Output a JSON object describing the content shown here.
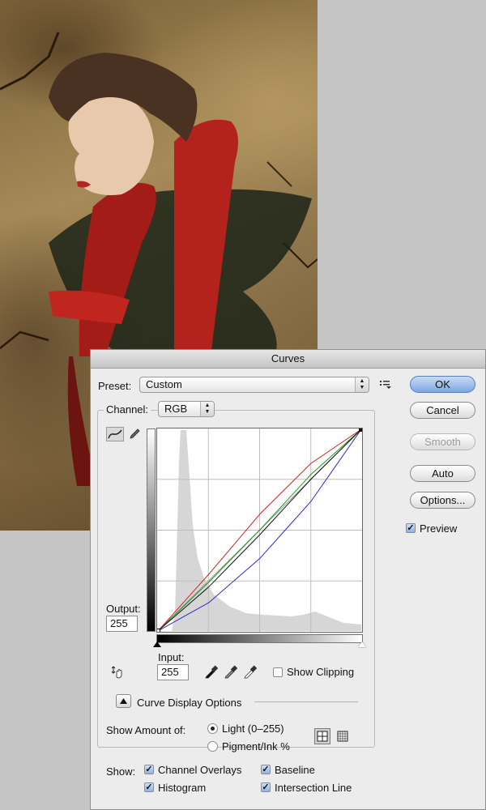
{
  "dialog": {
    "title": "Curves",
    "preset_label": "Preset:",
    "preset_value": "Custom",
    "channel_label": "Channel:",
    "channel_value": "RGB",
    "output_label": "Output:",
    "output_value": "255",
    "input_label": "Input:",
    "input_value": "255",
    "show_clipping_label": "Show Clipping",
    "show_clipping_checked": false,
    "curve_display_options_label": "Curve Display Options",
    "show_amount_label": "Show Amount of:",
    "light_label": "Light  (0–255)",
    "pigment_label": "Pigment/Ink %",
    "show_label": "Show:",
    "channel_overlays_label": "Channel Overlays",
    "baseline_label": "Baseline",
    "histogram_label": "Histogram",
    "intersection_label": "Intersection Line"
  },
  "buttons": {
    "ok": "OK",
    "cancel": "Cancel",
    "smooth": "Smooth",
    "auto": "Auto",
    "options": "Options...",
    "preview_label": "Preview"
  },
  "icons": {
    "preset_menu": "list-menu-icon",
    "curve_tool": "curve-tool-icon",
    "pencil_tool": "pencil-icon",
    "hand_tool": "on-image-adjust-icon",
    "eyedroppers": [
      "black-point-eyedropper-icon",
      "gray-point-eyedropper-icon",
      "white-point-eyedropper-icon"
    ],
    "grid_simple": "grid-4-icon",
    "grid_detailed": "grid-10-icon"
  },
  "colors": {
    "red_curve": "#d42020",
    "green_curve": "#1a9a1a",
    "blue_curve": "#2a2acc",
    "composite_curve": "#111111",
    "histogram": "#d6d6d6"
  },
  "curves": {
    "composite": [
      [
        0,
        0
      ],
      [
        64,
        56
      ],
      [
        128,
        122
      ],
      [
        192,
        192
      ],
      [
        255,
        255
      ]
    ],
    "red": [
      [
        0,
        0
      ],
      [
        64,
        72
      ],
      [
        128,
        148
      ],
      [
        192,
        212
      ],
      [
        255,
        255
      ]
    ],
    "green": [
      [
        0,
        0
      ],
      [
        64,
        62
      ],
      [
        128,
        128
      ],
      [
        192,
        198
      ],
      [
        255,
        255
      ]
    ],
    "blue": [
      [
        0,
        0
      ],
      [
        64,
        36
      ],
      [
        128,
        92
      ],
      [
        192,
        164
      ],
      [
        255,
        255
      ]
    ]
  }
}
